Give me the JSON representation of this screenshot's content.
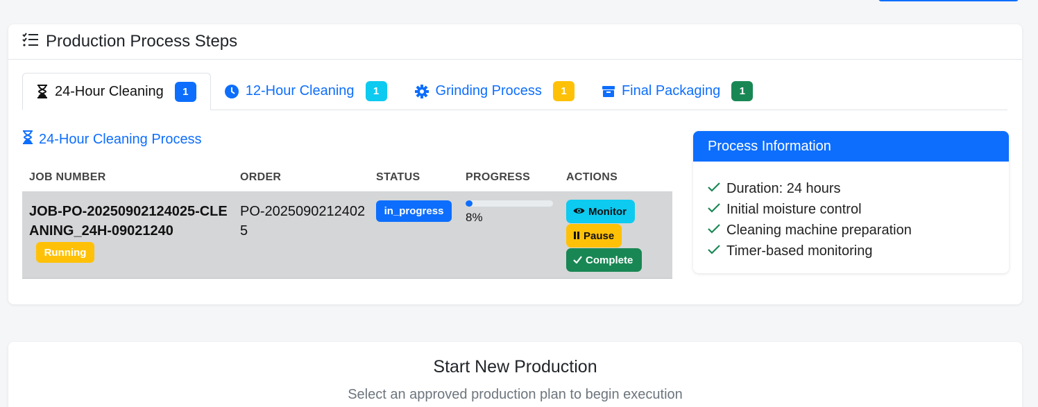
{
  "colors": {
    "primary": "#0d6efd",
    "info": "#0dcaf0",
    "warning": "#ffc107",
    "success": "#198754"
  },
  "card": {
    "title": "Production Process Steps",
    "icon": "list-check-icon"
  },
  "tabs": [
    {
      "label": "24-Hour Cleaning",
      "count": "1",
      "icon": "hourglass-icon",
      "badge_color": "#0d6efd",
      "active": true
    },
    {
      "label": "12-Hour Cleaning",
      "count": "1",
      "icon": "clock-icon",
      "badge_color": "#0dcaf0",
      "active": false
    },
    {
      "label": "Grinding Process",
      "count": "1",
      "icon": "gear-icon",
      "badge_color": "#ffc107",
      "active": false
    },
    {
      "label": "Final Packaging",
      "count": "1",
      "icon": "box-icon",
      "badge_color": "#198754",
      "active": false
    }
  ],
  "section": {
    "title": "24-Hour Cleaning Process",
    "icon": "hourglass-icon"
  },
  "table": {
    "headers": [
      "JOB NUMBER",
      "ORDER",
      "STATUS",
      "PROGRESS",
      "ACTIONS"
    ],
    "rows": [
      {
        "job_number": "JOB-PO-20250902124025-CLEANING_24H-09021240",
        "state_badge": "Running",
        "order": "PO-20250902124025",
        "status": "in_progress",
        "progress_fraction": 0.08,
        "progress_text": "8%",
        "actions": {
          "monitor": "Monitor",
          "pause": "Pause",
          "complete": "Complete"
        }
      }
    ]
  },
  "info": {
    "title": "Process Information",
    "items": [
      "Duration: 24 hours",
      "Initial moisture control",
      "Cleaning machine preparation",
      "Timer-based monitoring"
    ]
  },
  "start": {
    "title": "Start New Production",
    "subtitle": "Select an approved production plan to begin execution"
  }
}
